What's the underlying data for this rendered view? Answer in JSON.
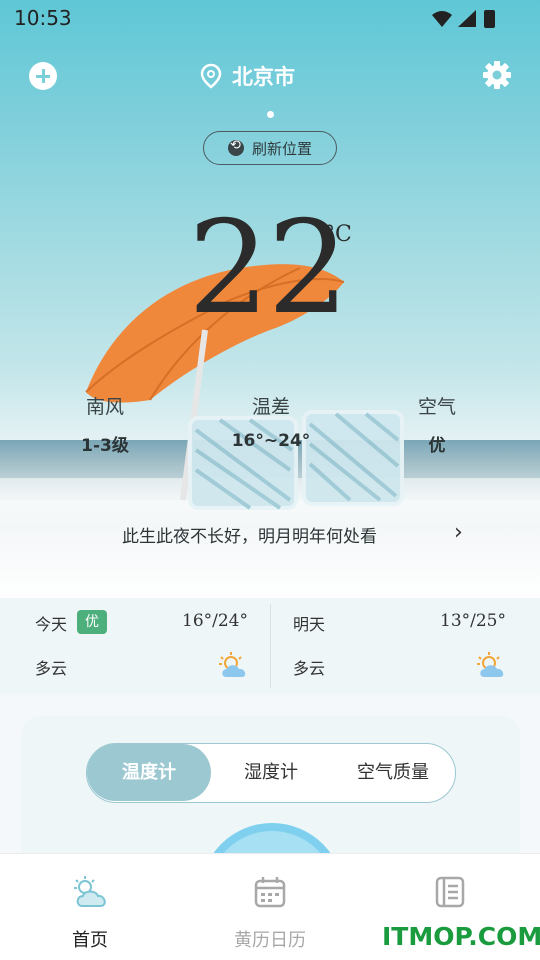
{
  "status_bar": {
    "time": "10:53"
  },
  "header": {
    "city": "北京市",
    "refresh_label": "刷新位置"
  },
  "current": {
    "temperature": "22",
    "unit": "°C"
  },
  "metrics": [
    {
      "label": "南风",
      "value": "1-3级"
    },
    {
      "label": "温差",
      "value": "16°~24°"
    },
    {
      "label": "空气",
      "value": "优"
    }
  ],
  "quote": "此生此夜不长好，明月明年何处看",
  "forecast": [
    {
      "day": "今天",
      "badge": "优",
      "range": "16°/24°",
      "condition": "多云",
      "icon": "partly-cloudy-icon"
    },
    {
      "day": "明天",
      "badge": "",
      "range": "13°/25°",
      "condition": "多云",
      "icon": "partly-cloudy-icon"
    }
  ],
  "tabs": [
    {
      "label": "温度计",
      "active": true
    },
    {
      "label": "湿度计",
      "active": false
    },
    {
      "label": "空气质量",
      "active": false
    }
  ],
  "bottom_nav": [
    {
      "label": "首页",
      "icon": "weather-icon",
      "active": true
    },
    {
      "label": "黄历日历",
      "icon": "calendar-icon",
      "active": false
    },
    {
      "label": "",
      "icon": "notes-icon",
      "active": false
    }
  ],
  "watermark": "ITMOP.COM",
  "colors": {
    "accent": "#9cc8d1",
    "badge_good": "#4caf7c",
    "sky": "#6ccad8"
  }
}
